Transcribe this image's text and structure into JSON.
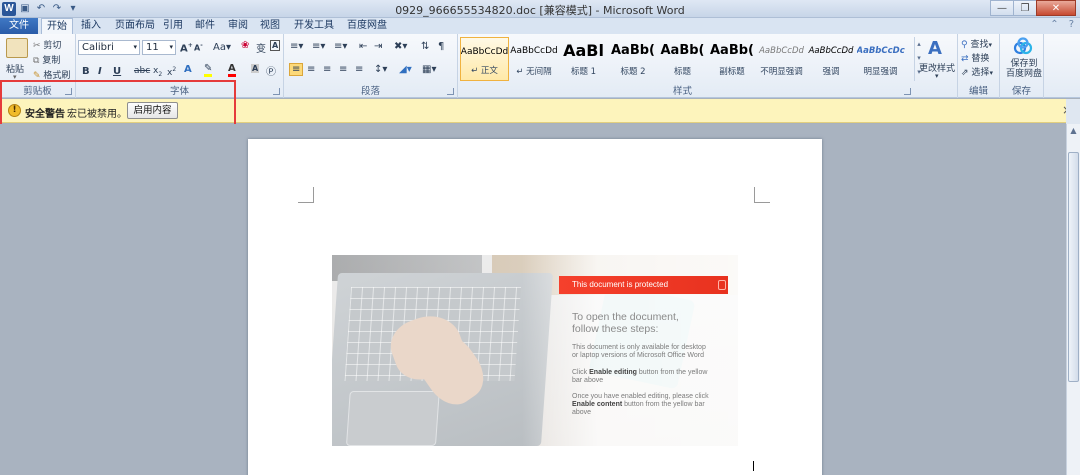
{
  "window": {
    "title": "0929_966655534820.doc [兼容模式] - Microsoft Word",
    "app_icon": "W"
  },
  "tabs": [
    "文件",
    "开始",
    "插入",
    "页面布局",
    "引用",
    "邮件",
    "审阅",
    "视图",
    "开发工具",
    "百度网盘"
  ],
  "active_tab": "开始",
  "ribbon": {
    "clipboard": {
      "paste": "粘贴",
      "cut": "剪切",
      "copy": "复制",
      "format_painter": "格式刷",
      "label": "剪贴板"
    },
    "font": {
      "name": "Calibri",
      "size": "11",
      "label": "字体"
    },
    "paragraph": {
      "label": "段落"
    },
    "styles": {
      "label": "样式",
      "items": [
        {
          "preview": "AaBbCcDd",
          "name": "↵ 正文"
        },
        {
          "preview": "AaBbCcDd",
          "name": "↵ 无间隔"
        },
        {
          "preview": "AaBl",
          "name": "标题 1"
        },
        {
          "preview": "AaBb(",
          "name": "标题 2"
        },
        {
          "preview": "AaBb(",
          "name": "标题"
        },
        {
          "preview": "AaBb(",
          "name": "副标题"
        },
        {
          "preview": "AaBbCcDd",
          "name": "不明显强调"
        },
        {
          "preview": "AaBbCcDd",
          "name": "强调"
        },
        {
          "preview": "AaBbCcDc",
          "name": "明显强调"
        }
      ],
      "change_styles": "更改样式"
    },
    "editing": {
      "find": "查找",
      "replace": "替换",
      "select": "选择",
      "label": "编辑"
    },
    "save": {
      "button": "保存到\n百度网盘",
      "line1": "保存到",
      "line2": "百度网盘",
      "label": "保存"
    }
  },
  "security_bar": {
    "title": "安全警告",
    "message": "宏已被禁用。",
    "button": "启用内容",
    "close": "×"
  },
  "document": {
    "banner": "This document is protected",
    "heading_line1": "To open the document,",
    "heading_line2": "follow these steps:",
    "para1_line1": "This document is only available for desktop",
    "para1_line2": "or laptop versions of Microsoft Office Word",
    "para2_prefix": "Click ",
    "para2_bold": "Enable editing",
    "para2_suffix": " button from the yellow",
    "para2_line2": "bar above",
    "para3_line1": "Once you have enabled editing, please click",
    "para3_bold": "Enable content",
    "para3_suffix": " button from the yellow bar",
    "para3_line3": "above"
  },
  "colors": {
    "warning_bar": "#fdf4bc",
    "highlight_box": "#e53b3b",
    "banner": "#f5402c",
    "file_tab": "#2a5ba8"
  }
}
